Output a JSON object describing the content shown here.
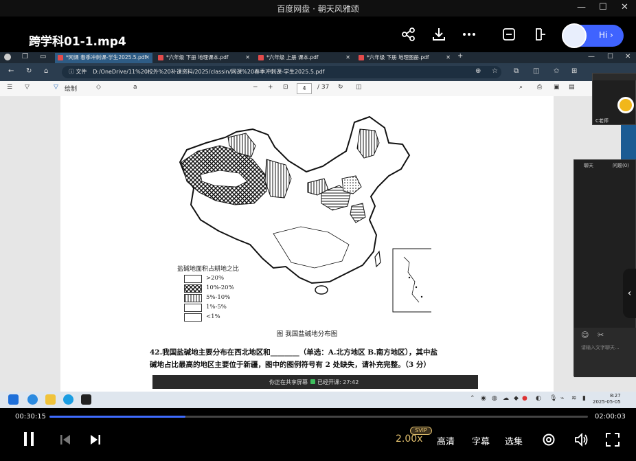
{
  "window": {
    "title": "百度网盘 · 朝天风雅颂"
  },
  "player_header": {
    "file_name": "跨学科01-1.mp4",
    "greeting": "Hi"
  },
  "browser": {
    "tabs": [
      {
        "label": "*网课 春季冲刺课-学生2025.5.pdf",
        "active": true
      },
      {
        "label": "*六年级 下册 地理课本.pdf",
        "active": false
      },
      {
        "label": "*六年级 上册 课本.pdf",
        "active": false
      },
      {
        "label": "*六年级 下册 地理图册.pdf",
        "active": false
      }
    ],
    "address_prefix": "文件",
    "address": "D:/OneDrive/11%20校外%20补课资料/2025/classin/网课%20春季冲刺课-学生2025.5.pdf"
  },
  "pdf_toolbar": {
    "draw_label": "绘制",
    "page_current": "4",
    "page_total": "/ 37"
  },
  "document": {
    "legend_title": "盐碱地面积占耕地之比",
    "legend_items": [
      {
        "label": ">20%",
        "pattern": "blank"
      },
      {
        "label": "10%-20%",
        "pattern": "cross"
      },
      {
        "label": "5%-10%",
        "pattern": "vertical"
      },
      {
        "label": "1%-5%",
        "pattern": "blank"
      },
      {
        "label": "<1%",
        "pattern": "blank"
      }
    ],
    "caption": "图  我国盐碱地分布图",
    "question_line1": "42.我国盐碱地主要分布在西北地区和________（单选：A.北方地区  B.南方地区），其中盐",
    "question_line2": "碱地占比最高的地区主要位于新疆，图中的图例符号有 2 处缺失，请补充完整。（3 分）"
  },
  "share_bar": {
    "sharing_text": "你正在共享屏幕",
    "class_time": "已经开课: 27:42"
  },
  "classin": {
    "teacher_name": "C老师",
    "chat_tab": "聊天",
    "qa_tab": "问题(0)",
    "chat_placeholder": "请输入文字聊天..."
  },
  "taskbar": {
    "time": "8:27",
    "date": "2025-05-05"
  },
  "player": {
    "current_time": "00:30:15",
    "total_time": "02:00:03",
    "progress": 0.252,
    "rate": "2.00x",
    "rate_badge": "SVIP",
    "quality": "高清",
    "subtitle": "字幕",
    "episodes": "选集"
  }
}
